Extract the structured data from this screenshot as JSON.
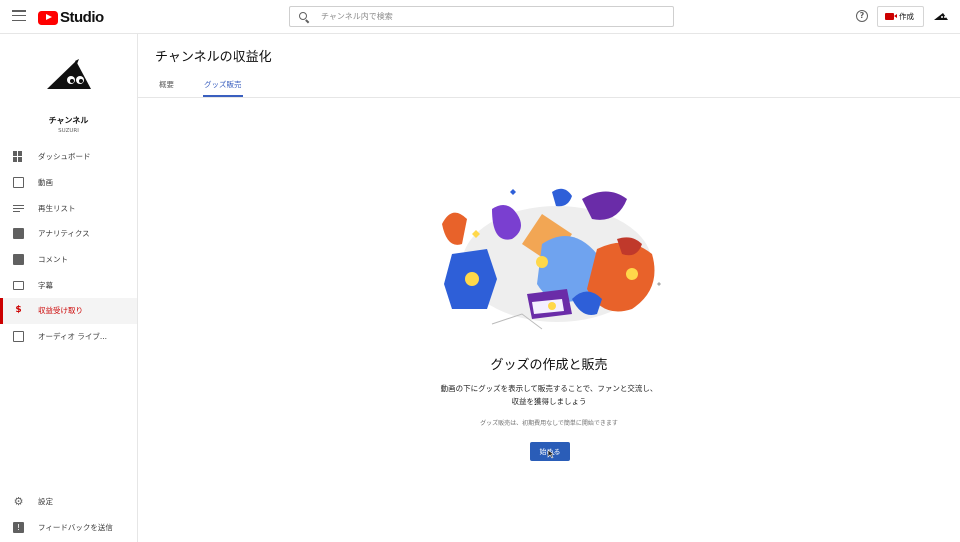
{
  "header": {
    "logo_text": "Studio",
    "search_placeholder": "チャンネル内で検索",
    "help_glyph": "?",
    "create_label": "作成"
  },
  "sidebar": {
    "channel_name": "チャンネル",
    "channel_sub": "SUZURI",
    "items": [
      {
        "label": "ダッシュボード",
        "icon": "dashboard-icon"
      },
      {
        "label": "動画",
        "icon": "video-icon"
      },
      {
        "label": "再生リスト",
        "icon": "playlist-icon"
      },
      {
        "label": "アナリティクス",
        "icon": "analytics-icon"
      },
      {
        "label": "コメント",
        "icon": "comment-icon"
      },
      {
        "label": "字幕",
        "icon": "subtitles-icon"
      },
      {
        "label": "収益受け取り",
        "icon": "dollar-icon",
        "active": true
      },
      {
        "label": "オーディオ ライブ...",
        "icon": "audio-library-icon"
      }
    ],
    "bottom_items": [
      {
        "label": "設定",
        "icon": "gear-icon"
      },
      {
        "label": "フィードバックを送信",
        "icon": "feedback-icon"
      }
    ]
  },
  "main": {
    "title": "チャンネルの収益化",
    "tabs": [
      {
        "label": "概要"
      },
      {
        "label": "グッズ販売",
        "active": true
      }
    ],
    "heading": "グッズの作成と販売",
    "description_line1": "動画の下にグッズを表示して販売することで、ファンと交流し、",
    "description_line2": "収益を獲得しましょう",
    "note": "グッズ販売は、初期費用なしで簡単に開始できます",
    "start_button": "始める"
  },
  "colors": {
    "accent_red": "#cc0000",
    "primary_blue": "#2a5db8",
    "tab_blue": "#3a5fbf"
  }
}
